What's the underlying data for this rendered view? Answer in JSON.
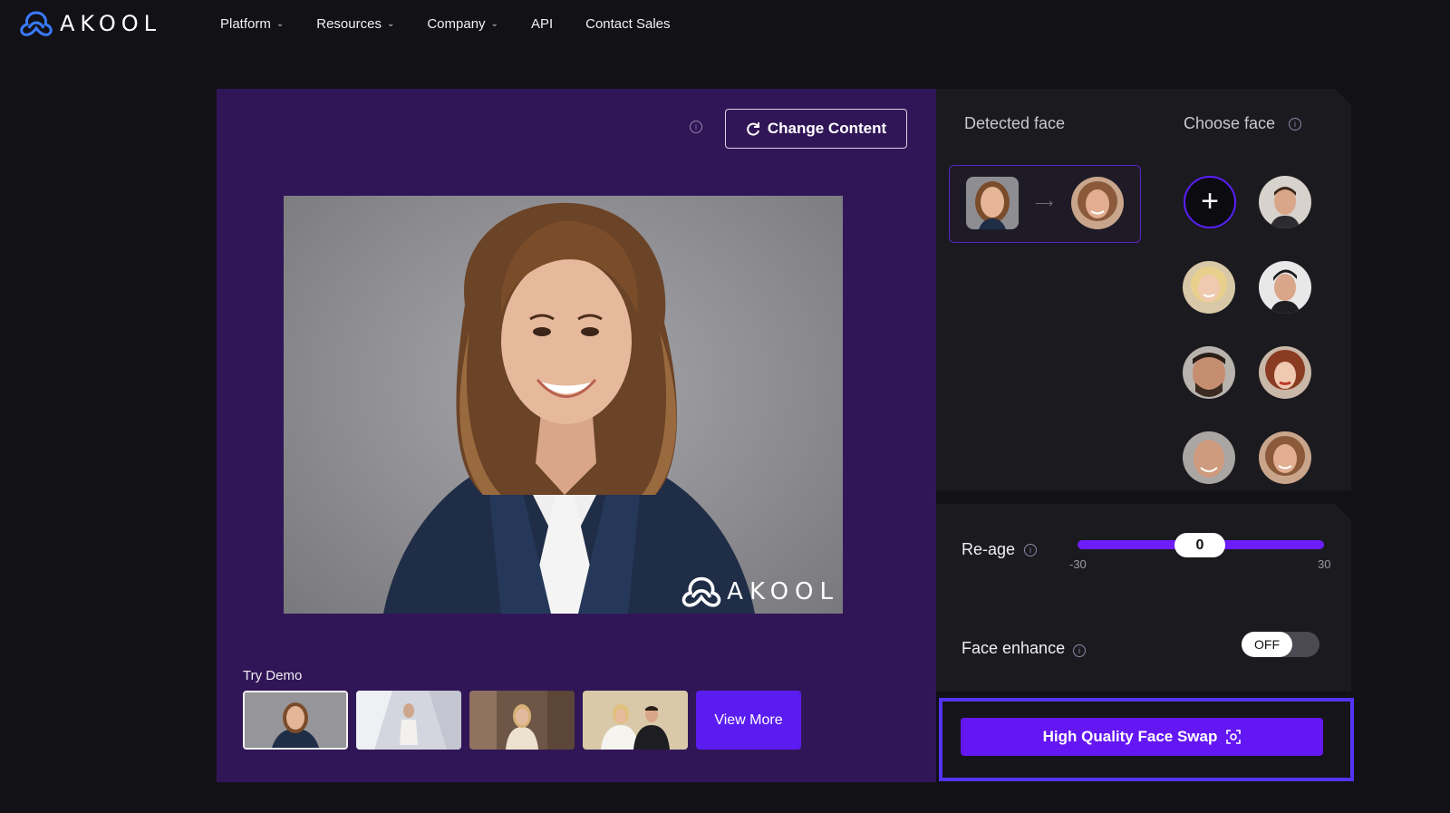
{
  "brand": {
    "name": "AKOOL"
  },
  "nav": [
    {
      "label": "Platform",
      "has_menu": true
    },
    {
      "label": "Resources",
      "has_menu": true
    },
    {
      "label": "Company",
      "has_menu": true
    },
    {
      "label": "API",
      "has_menu": false
    },
    {
      "label": "Contact Sales",
      "has_menu": false
    }
  ],
  "editor": {
    "change_content_label": "Change Content",
    "watermark": "AKOOL",
    "try_demo_label": "Try Demo",
    "view_more_label": "View More"
  },
  "faces": {
    "detected_label": "Detected face",
    "choose_label": "Choose face"
  },
  "settings": {
    "reage_label": "Re-age",
    "reage_value": "0",
    "reage_min": "-30",
    "reage_max": "30",
    "enhance_label": "Face enhance",
    "enhance_state": "OFF"
  },
  "cta": {
    "label": "High Quality Face Swap"
  },
  "colors": {
    "accent": "#6416f3",
    "panel_purple": "#311657",
    "highlight_border": "#5135f5"
  }
}
